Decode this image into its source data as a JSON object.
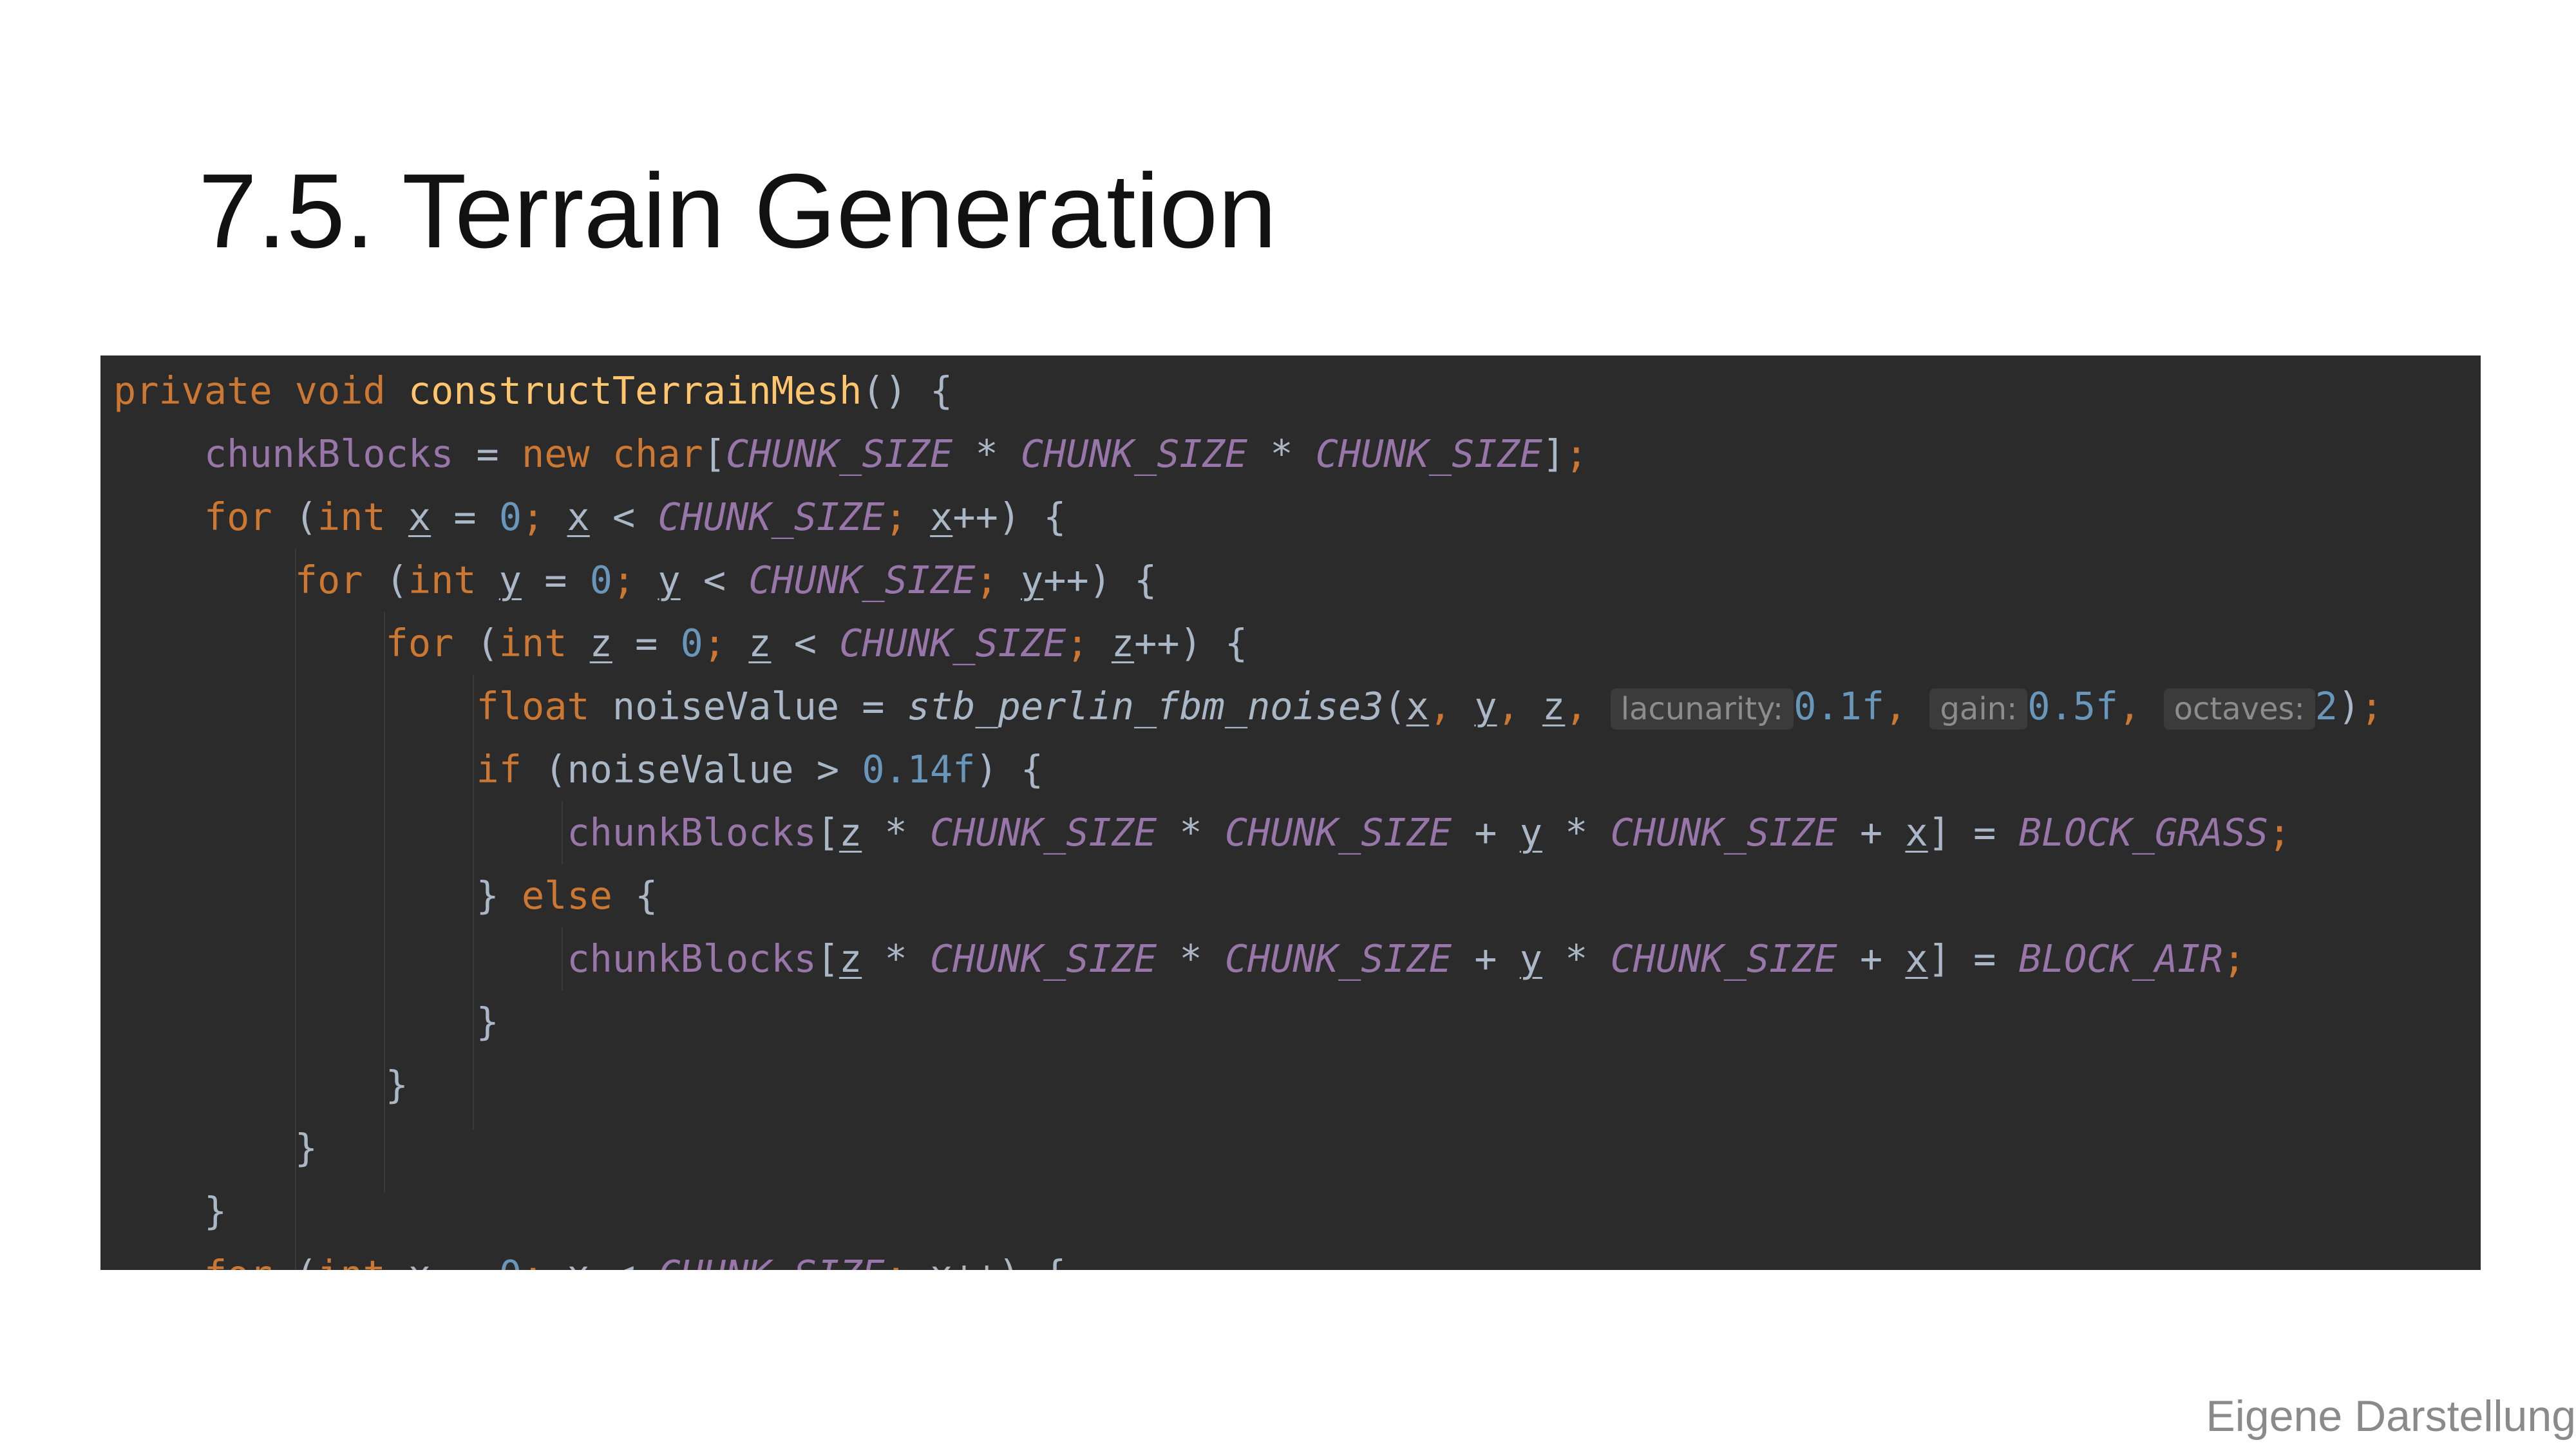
{
  "slide": {
    "title": "7.5. Terrain Generation",
    "caption": "Eigene Darstellung"
  },
  "code": {
    "keywords": {
      "private": "private",
      "void": "void",
      "new": "new",
      "char": "char",
      "for": "for",
      "int": "int",
      "float": "float",
      "if": "if",
      "else": "else"
    },
    "method_name": "constructTerrainMesh",
    "field_chunk_blocks": "chunkBlocks",
    "const_chunk_size": "CHUNK_SIZE",
    "const_block_grass": "BLOCK_GRASS",
    "const_block_air": "BLOCK_AIR",
    "var_x": "x",
    "var_y": "y",
    "var_z": "z",
    "var_noise": "noiseValue",
    "noise_function": "stb_perlin_fbm_noise3",
    "hint_lacunarity": "lacunarity:",
    "hint_gain": "gain:",
    "hint_octaves": "octaves:",
    "val_zero": "0",
    "val_lacunarity": "0.1f",
    "val_gain": "0.5f",
    "val_octaves": "2",
    "val_threshold": "0.14f"
  },
  "colors": {
    "editor_background": "#2b2b2b",
    "keyword": "#cc7832",
    "method": "#ffc66d",
    "field_and_constant": "#9876aa",
    "number": "#6897bb",
    "default_text": "#a9b7c6"
  }
}
